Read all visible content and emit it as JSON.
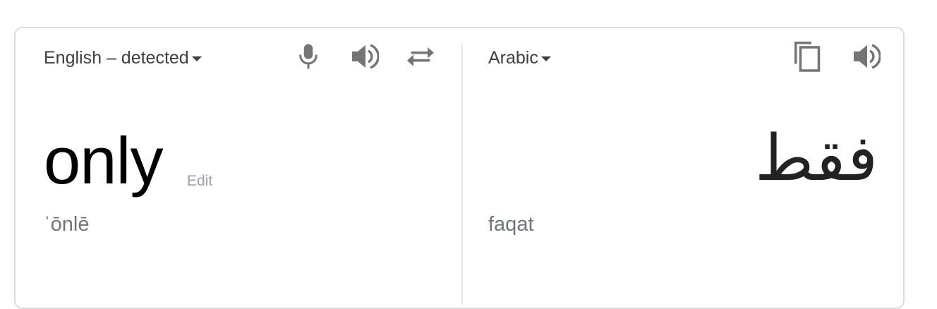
{
  "source": {
    "language_label": "English – detected",
    "text": "only",
    "edit_label": "Edit",
    "transliteration": "ˈōnlē",
    "icons": [
      "microphone-icon",
      "speaker-icon",
      "swap-icon"
    ]
  },
  "target": {
    "language_label": "Arabic",
    "text": "فقط",
    "transliteration": "faqat",
    "icons": [
      "copy-icon",
      "speaker-icon"
    ]
  },
  "colors": {
    "icon": "#757575",
    "text": "#3c4043",
    "muted": "#70757a",
    "border": "#dadce0"
  }
}
